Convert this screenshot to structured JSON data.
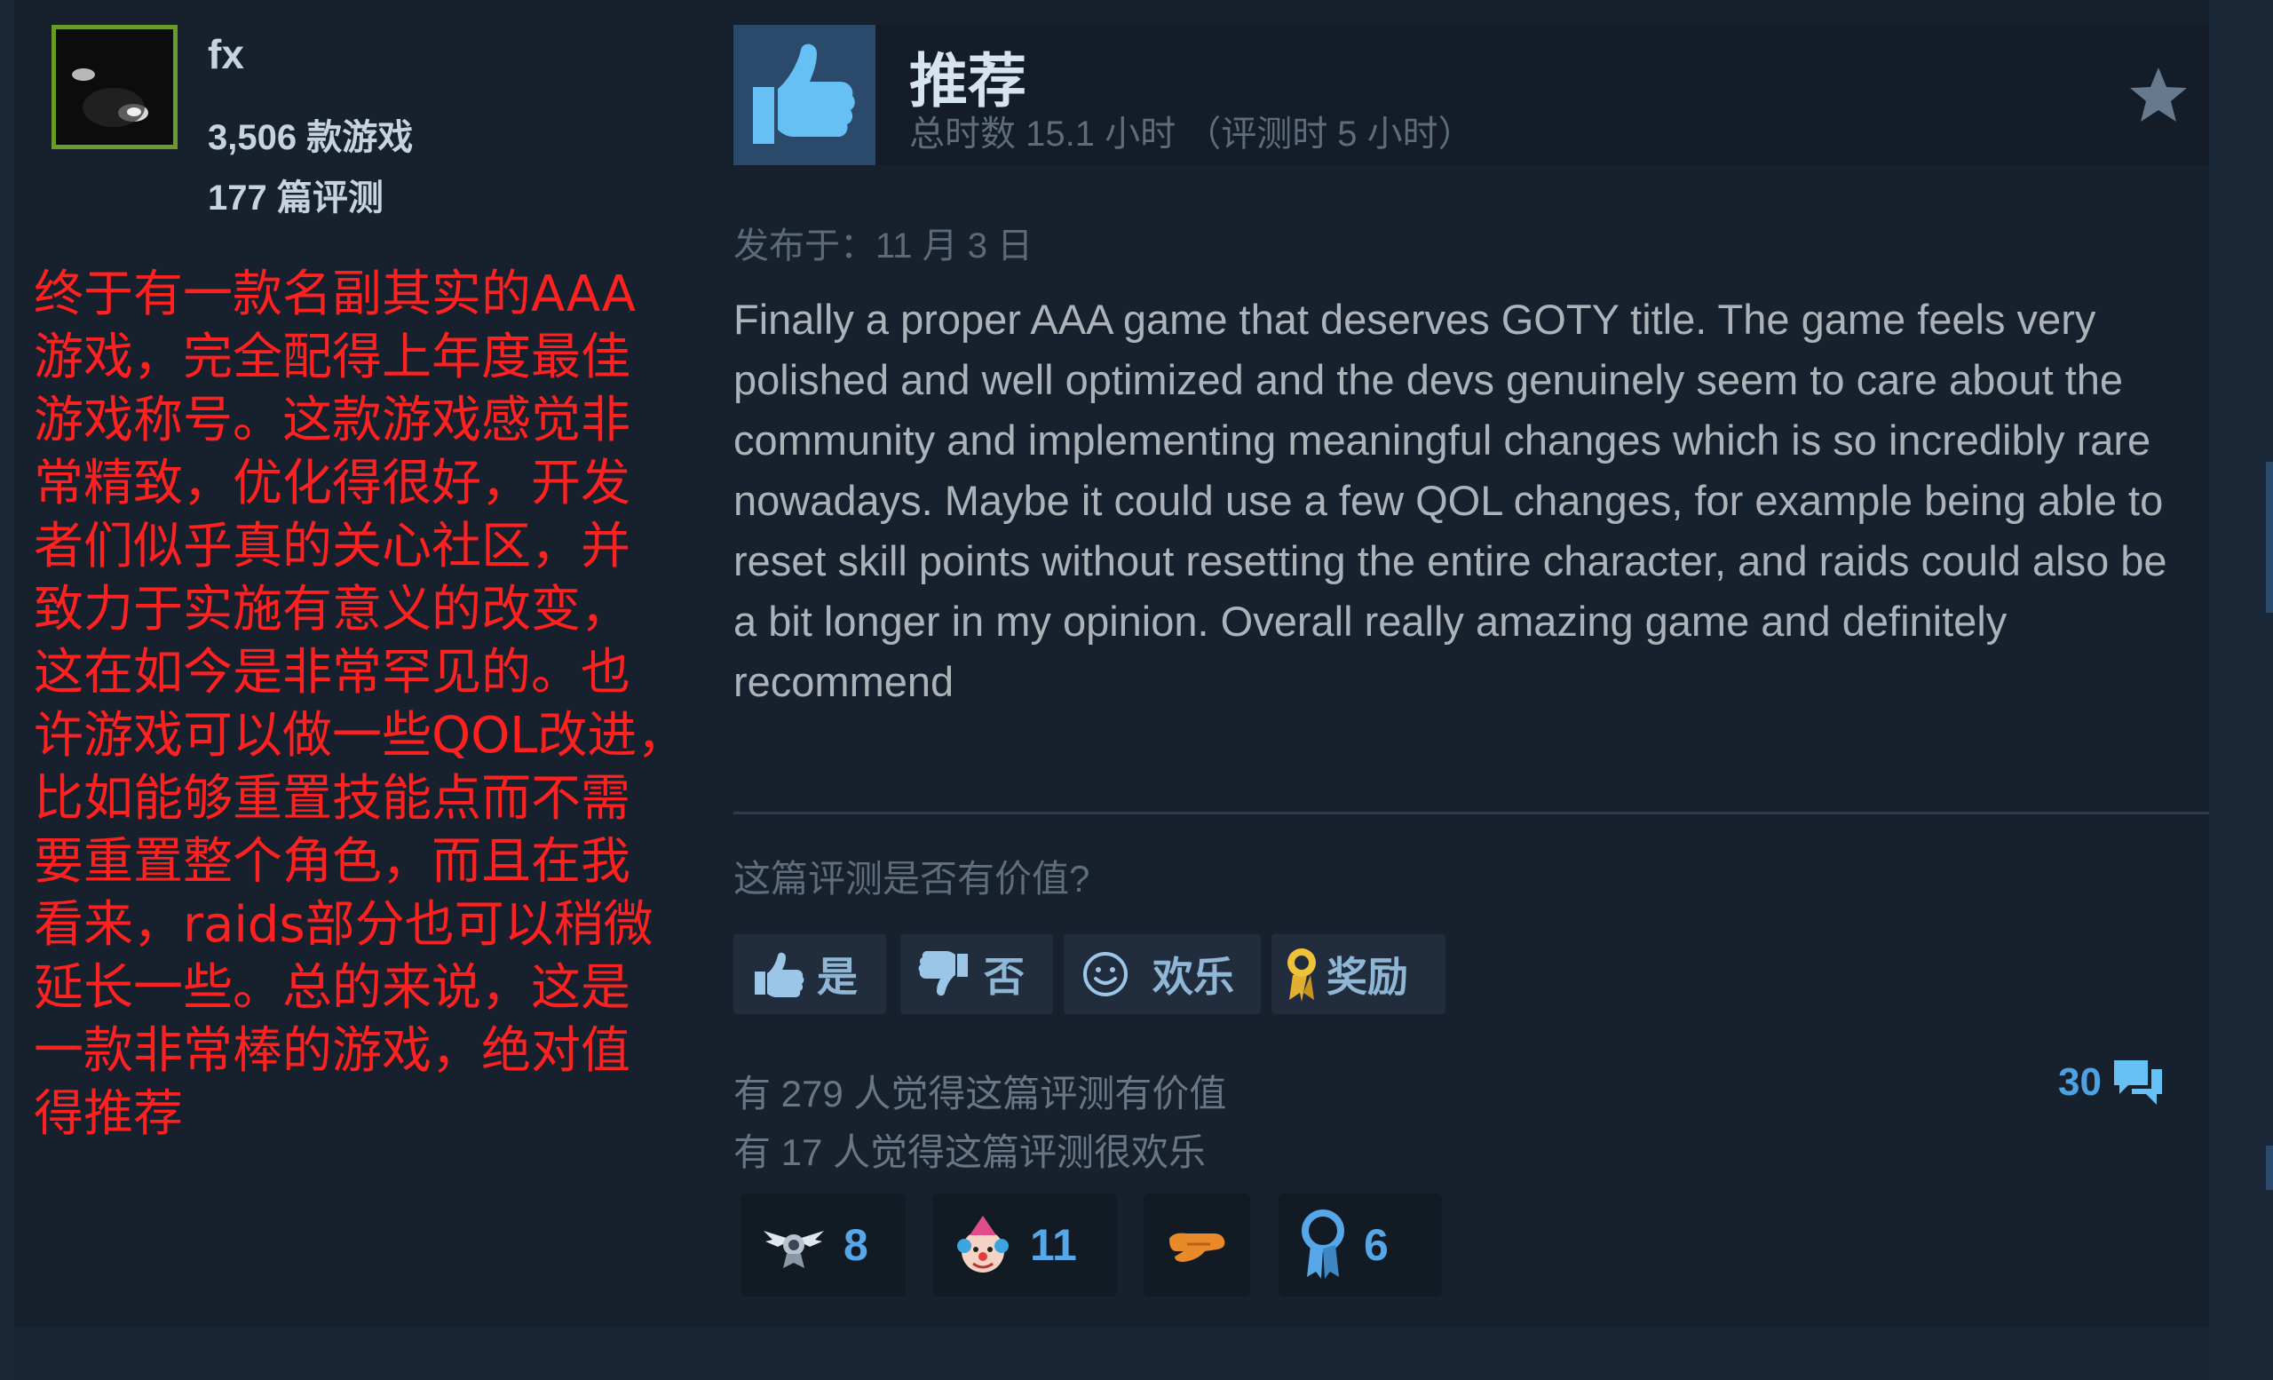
{
  "user": {
    "name": "fx",
    "games": "3,506 款游戏",
    "reviews": "177 篇评测"
  },
  "translation": "终于有一款名副其实的AAA\n游戏，完全配得上年度最佳\n游戏称号。这款游戏感觉非\n常精致，优化得很好，开发\n者们似乎真的关心社区，并\n致力于实施有意义的改变，\n这在如今是非常罕见的。也\n许游戏可以做一些QOL改进，\n比如能够重置技能点而不需\n要重置整个角色，而且在我\n看来，raids部分也可以稍微\n延长一些。总的来说，这是\n一款非常棒的游戏，绝对值\n得推荐",
  "review": {
    "verdict": "推荐",
    "hours": "总时数 15.1 小时 （评测时 5 小时）",
    "posted": "发布于：11 月 3 日",
    "body": "Finally a proper AAA game that deserves GOTY title. The game feels very polished and well optimized and the devs genuinely seem to care about the community and implementing meaningful changes which is so incredibly rare nowadays. Maybe it could use a few QOL changes, for example being able to reset skill points without resetting the entire character, and raids could also be a bit longer in my opinion. Overall really amazing game and definitely recommend"
  },
  "feedback": {
    "question": "这篇评测是否有价值?",
    "yes": "是",
    "no": "否",
    "funny": "欢乐",
    "award": "奖励",
    "helpful_count": "有 279 人觉得这篇评测有价值",
    "funny_count": "有 17 人觉得这篇评测很欢乐",
    "comments": "30"
  },
  "awards": [
    {
      "icon": "winged-award-icon",
      "count": "8"
    },
    {
      "icon": "clown-face-award-icon",
      "count": "11"
    },
    {
      "icon": "hand-award-icon",
      "count": ""
    },
    {
      "icon": "ribbon-medal-award-icon",
      "count": "6"
    }
  ],
  "colors": {
    "accent": "#4fa2e0",
    "translation_text": "#ff2020",
    "avatar_border": "#6a9a28",
    "thumb_bg": "#2b4a6b"
  }
}
